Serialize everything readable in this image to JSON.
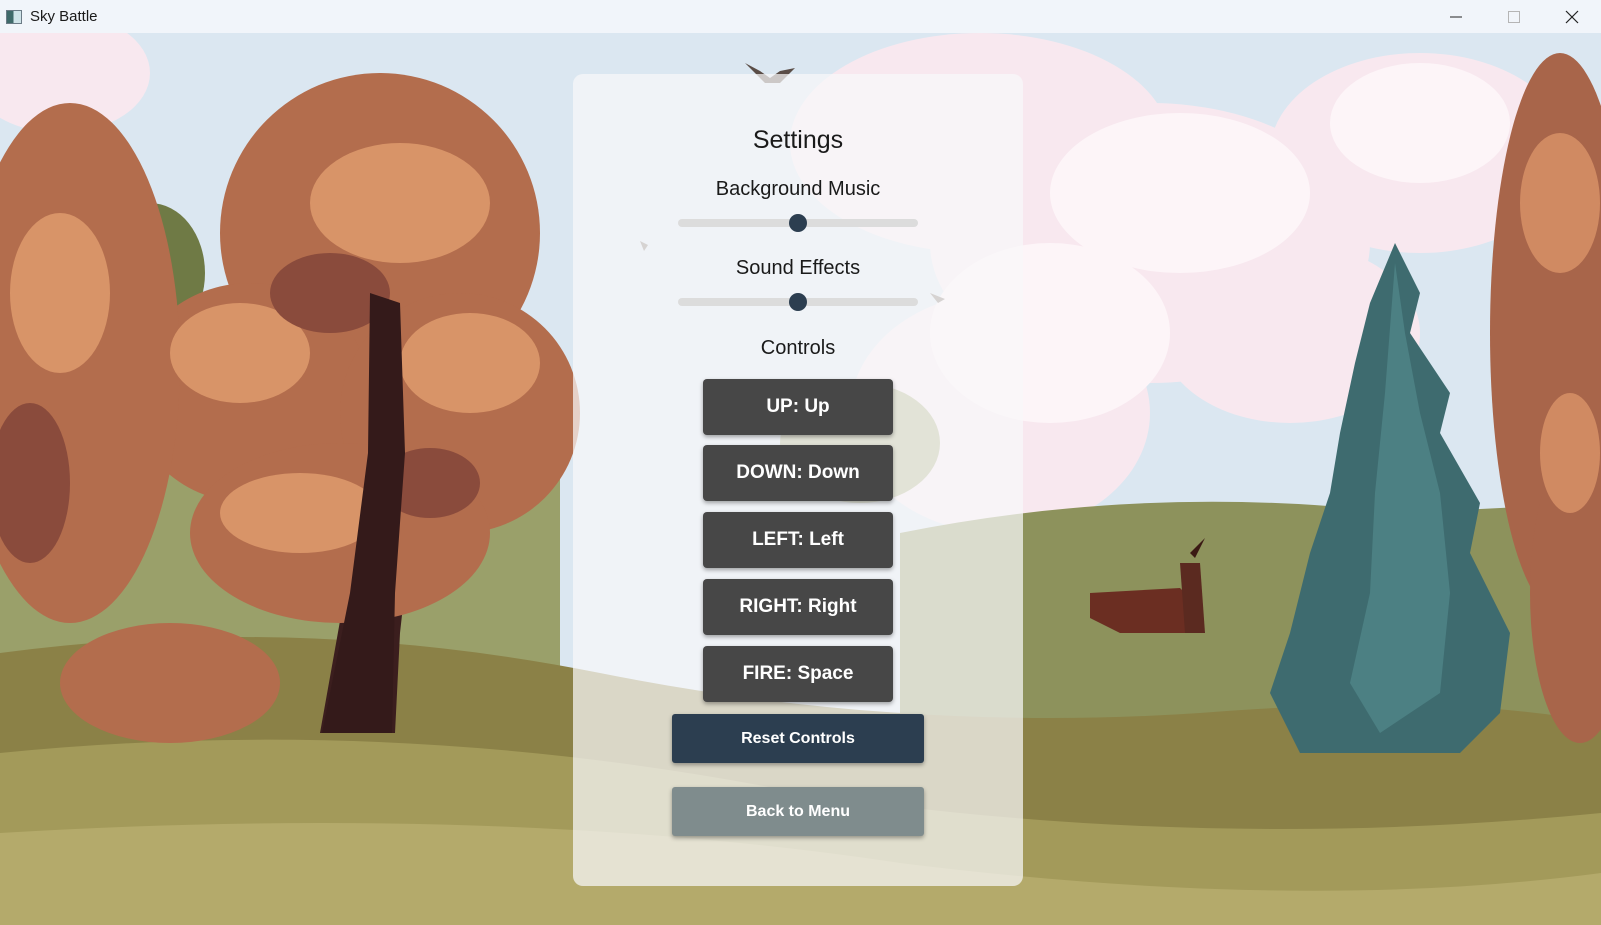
{
  "window": {
    "title": "Sky Battle",
    "minimize_icon": "minimize-icon",
    "maximize_icon": "maximize-icon",
    "close_icon": "close-icon"
  },
  "settings": {
    "title": "Settings",
    "background_music": {
      "label": "Background Music",
      "value": 0.5
    },
    "sound_effects": {
      "label": "Sound Effects",
      "value": 0.5
    },
    "controls_heading": "Controls",
    "controls": [
      {
        "label": "UP: Up"
      },
      {
        "label": "DOWN: Down"
      },
      {
        "label": "LEFT: Left"
      },
      {
        "label": "RIGHT: Right"
      },
      {
        "label": "FIRE: Space"
      }
    ],
    "reset_label": "Reset Controls",
    "back_label": "Back to Menu"
  },
  "colors": {
    "slider_thumb": "#2c3e50",
    "key_button": "#474747",
    "reset_button": "#2c3e50",
    "back_button": "#7f8c8d",
    "sky": "#dfe9f3"
  }
}
